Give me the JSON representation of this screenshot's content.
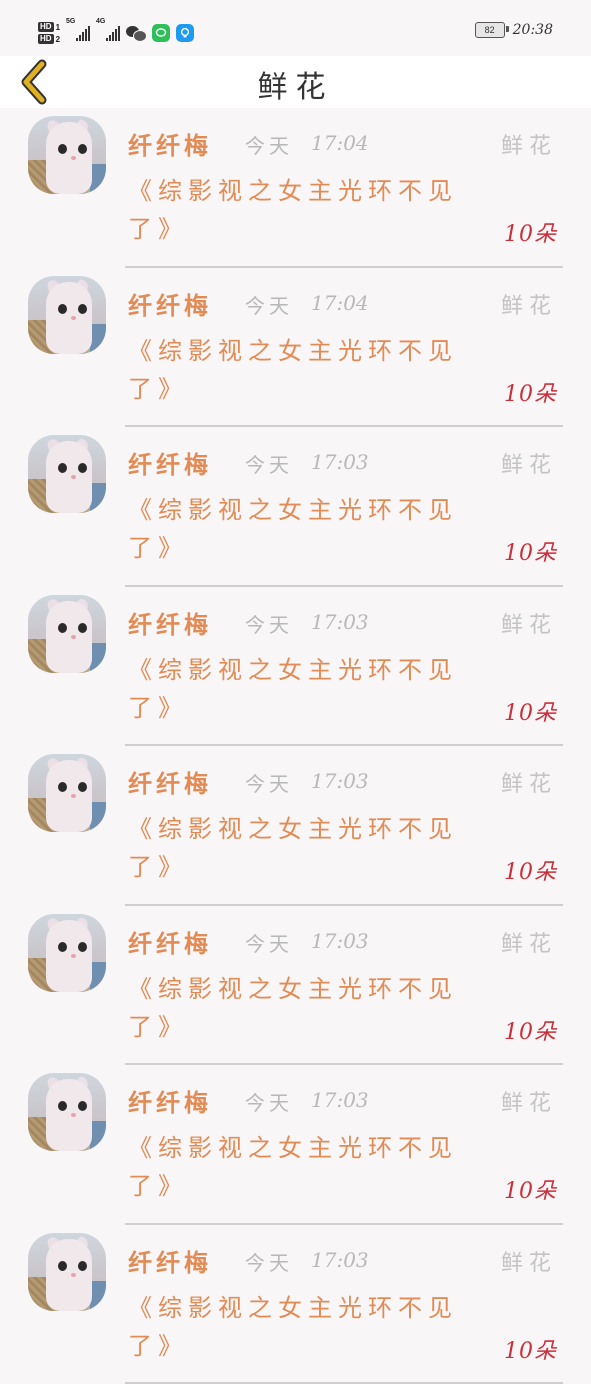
{
  "status_bar": {
    "hd1": "HD",
    "hd1_num": "1",
    "hd2": "HD",
    "hd2_num": "2",
    "signal1_label": "5G",
    "signal2_label": "4G",
    "battery": "82",
    "time": "20:38",
    "icons": [
      "wechat-icon",
      "message-icon",
      "lightbulb-icon"
    ],
    "colors": {
      "message_app": "#2fbf5a",
      "lightbulb_app": "#1e9bf0"
    }
  },
  "header": {
    "title": "鲜花",
    "back_icon": "chevron-left-icon",
    "back_color": "#e0b020"
  },
  "list": {
    "items": [
      {
        "name": "纤纤梅",
        "day": "今天",
        "time": "17:04",
        "type": "鲜花",
        "book": "《综影视之女主光环不见了》",
        "amount": "10朵"
      },
      {
        "name": "纤纤梅",
        "day": "今天",
        "time": "17:04",
        "type": "鲜花",
        "book": "《综影视之女主光环不见了》",
        "amount": "10朵"
      },
      {
        "name": "纤纤梅",
        "day": "今天",
        "time": "17:03",
        "type": "鲜花",
        "book": "《综影视之女主光环不见了》",
        "amount": "10朵"
      },
      {
        "name": "纤纤梅",
        "day": "今天",
        "time": "17:03",
        "type": "鲜花",
        "book": "《综影视之女主光环不见了》",
        "amount": "10朵"
      },
      {
        "name": "纤纤梅",
        "day": "今天",
        "time": "17:03",
        "type": "鲜花",
        "book": "《综影视之女主光环不见了》",
        "amount": "10朵"
      },
      {
        "name": "纤纤梅",
        "day": "今天",
        "time": "17:03",
        "type": "鲜花",
        "book": "《综影视之女主光环不见了》",
        "amount": "10朵"
      },
      {
        "name": "纤纤梅",
        "day": "今天",
        "time": "17:03",
        "type": "鲜花",
        "book": "《综影视之女主光环不见了》",
        "amount": "10朵"
      },
      {
        "name": "纤纤梅",
        "day": "今天",
        "time": "17:03",
        "type": "鲜花",
        "book": "《综影视之女主光环不见了》",
        "amount": "10朵"
      }
    ]
  },
  "colors": {
    "name": "#e38b55",
    "meta": "#b8b8b8",
    "amount": "#c9303c",
    "background": "#f8f6f7"
  }
}
